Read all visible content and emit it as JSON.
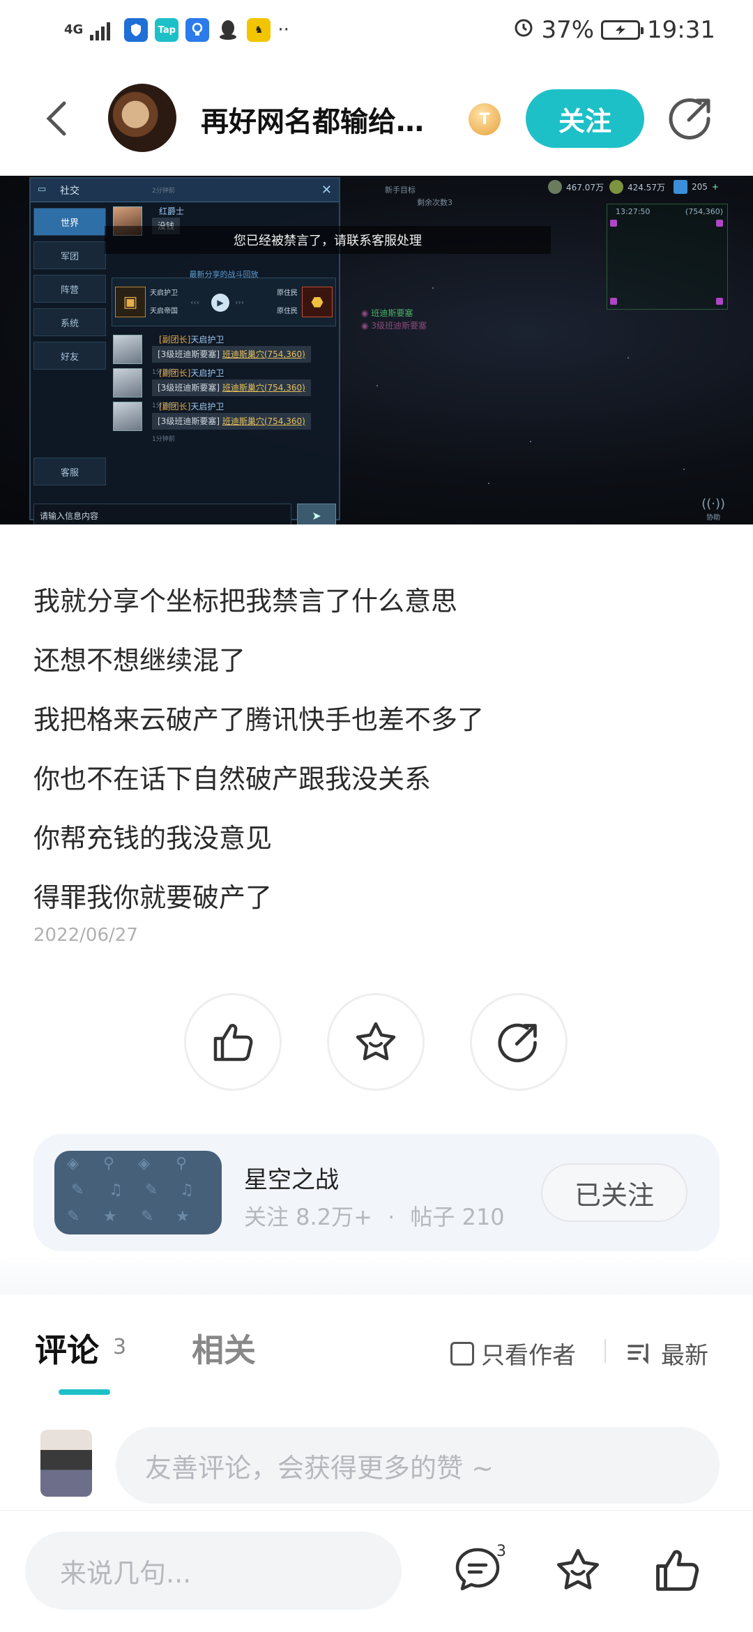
{
  "status_bar": {
    "network": "4G",
    "apps": [
      {
        "icon": "shield-app-icon",
        "color": "#1f6fd6"
      },
      {
        "icon": "taptap-app-icon",
        "label": "Tap",
        "color": "#1ec0c8"
      },
      {
        "icon": "bulb-app-icon",
        "color": "#2b7bea"
      },
      {
        "icon": "qq-app-icon",
        "color": "#333333"
      },
      {
        "icon": "game-app-icon",
        "color": "#f2c500"
      }
    ],
    "more": "··",
    "battery": "37%",
    "time": "19:31"
  },
  "header": {
    "author": "再好网名都输给…",
    "level_badge": "T",
    "follow_label": "关注"
  },
  "screenshot": {
    "panel_title": "社交",
    "tabs": [
      "世界",
      "军团",
      "阵营",
      "系统",
      "好友"
    ],
    "service_tab": "客服",
    "first_sender": "红爵士",
    "first_message": "没钱",
    "first_time": "2分钟前",
    "share_header": "最新分享的战斗回放",
    "share_left_name": "天启护卫",
    "share_left_sub": "天启帝国",
    "share_right_name": "原住民",
    "share_right_sub": "原住民",
    "messages": [
      {
        "rank": "[副团长]",
        "name": "天启护卫",
        "text": "[3级班迪斯要塞] ",
        "link": "班迪斯巢穴(754,360)",
        "time": "1分钟前"
      },
      {
        "rank": "[副团长]",
        "name": "天启护卫",
        "text": "[3级班迪斯要塞] ",
        "link": "班迪斯巢穴(754,360)",
        "time": "1分钟前"
      },
      {
        "rank": "[副团长]",
        "name": "天启护卫",
        "text": "[3级班迪斯要塞] ",
        "link": "班迪斯巢穴(754,360)",
        "time": "1分钟前"
      }
    ],
    "input_placeholder": "请输入信息内容",
    "banned_notice": "您已经被禁言了，请联系客服处理",
    "resources": [
      "467.07万",
      "424.57万",
      "205"
    ],
    "mission_line1": "新手目标",
    "mission_line2": "剩余次数3",
    "minimap_time": "13:27:50",
    "minimap_coords": "(754,360)",
    "fort_name": "班迪斯要塞",
    "fort_label": "3级班迪斯要塞",
    "help_label": "协助"
  },
  "post": {
    "lines": [
      "我就分享个坐标把我禁言了什么意思",
      "还想不想继续混了",
      "我把格来云破产了腾讯快手也差不多了",
      "你也不在话下自然破产跟我没关系",
      "你帮充钱的我没意见",
      "得罪我你就要破产了"
    ],
    "date": "2022/06/27"
  },
  "game_card": {
    "title": "星空之战",
    "followers": "关注 8.2万+",
    "dot": "·",
    "posts": "帖子 210",
    "follow_state": "已关注"
  },
  "comments": {
    "tab_label": "评论",
    "count": "3",
    "related_label": "相关",
    "only_author": "只看作者",
    "sort_label": "最新",
    "input_placeholder": "友善评论，会获得更多的赞 ~"
  },
  "bottom_bar": {
    "say_placeholder": "来说几句...",
    "comment_badge": "3"
  },
  "colors": {
    "accent": "#1ec0c8"
  }
}
